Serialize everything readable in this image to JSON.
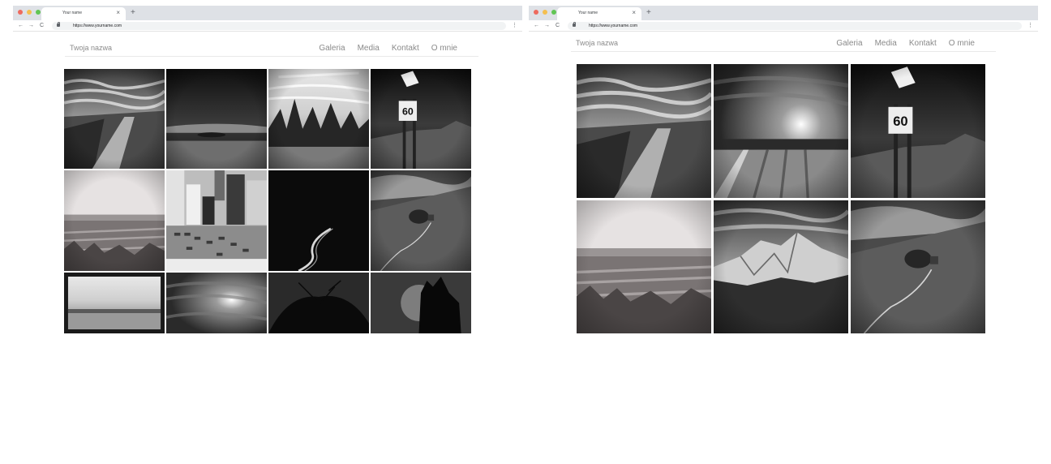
{
  "browser": {
    "tab_title": "Your name",
    "tab_close": "×",
    "new_tab": "+",
    "back": "←",
    "forward": "→",
    "reload": "C",
    "url": "https://www.yourname.com",
    "menu": "⋮",
    "traffic_lights": [
      "#ee6a5e",
      "#f5bf4f",
      "#61c554"
    ]
  },
  "site": {
    "brand": "Twoja nazwa",
    "nav": [
      "Galeria",
      "Media",
      "Kontakt",
      "O mnie"
    ]
  },
  "galleries": {
    "desktop": [
      "road-path",
      "dark-sea",
      "pine-forest",
      "speed-sign",
      "field",
      "city-parking",
      "night-road",
      "hill-tree",
      "coast",
      "sky-sun",
      "tree-silhouette",
      "dark-cliff"
    ],
    "wide": [
      "road-path",
      "sky-sun",
      "speed-sign",
      "field",
      "mountain",
      "hill-tree"
    ]
  }
}
